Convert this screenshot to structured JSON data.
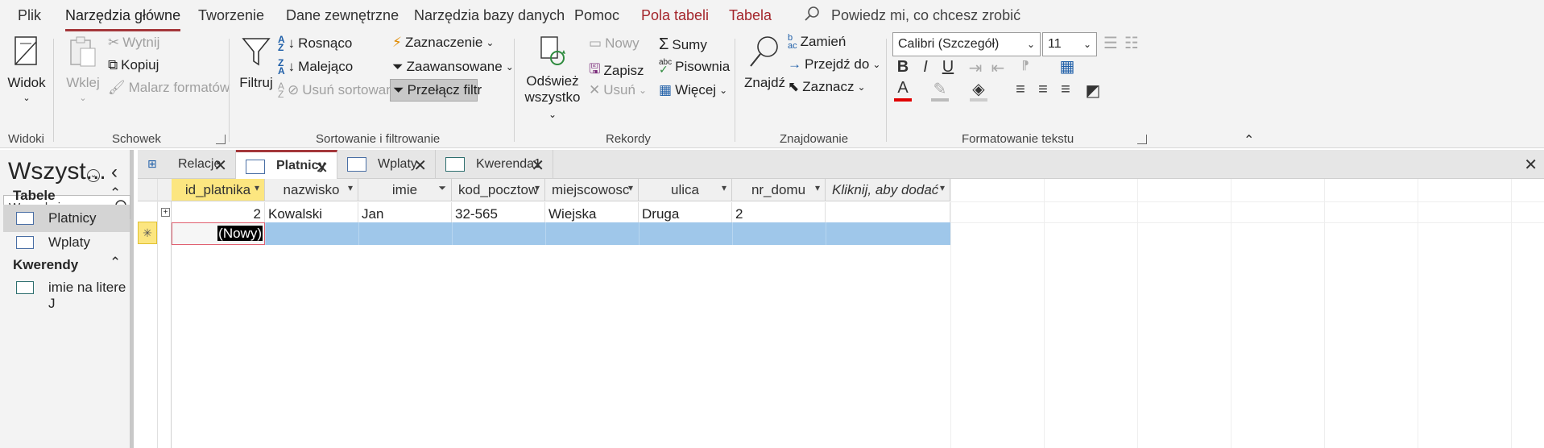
{
  "menu": {
    "tabs": [
      "Plik",
      "Narzędzia główne",
      "Tworzenie",
      "Dane zewnętrzne",
      "Narzędzia bazy danych",
      "Pomoc",
      "Pola tabeli",
      "Tabela"
    ],
    "tell_me": "Powiedz mi, co chcesz zrobić"
  },
  "ribbon": {
    "widoki": {
      "view": "Widok",
      "label": "Widoki"
    },
    "schowek": {
      "paste": "Wklej",
      "cut": "Wytnij",
      "copy": "Kopiuj",
      "painter": "Malarz formatów",
      "label": "Schowek"
    },
    "sort": {
      "filter": "Filtruj",
      "asc": "Rosnąco",
      "desc": "Malejąco",
      "remove": "Usuń sortowanie",
      "selection": "Zaznaczenie",
      "advanced": "Zaawansowane",
      "toggle": "Przełącz filtr",
      "label": "Sortowanie i filtrowanie"
    },
    "records": {
      "refresh1": "Odśwież",
      "refresh2": "wszystko",
      "new": "Nowy",
      "save": "Zapisz",
      "delete": "Usuń",
      "totals": "Sumy",
      "spelling": "Pisownia",
      "more": "Więcej",
      "label": "Rekordy"
    },
    "find": {
      "find": "Znajdź",
      "replace": "Zamień",
      "goto": "Przejdź do",
      "select": "Zaznacz",
      "label": "Znajdowanie"
    },
    "format": {
      "font": "Calibri (Szczegół)",
      "size": "11",
      "label": "Formatowanie tekstu"
    }
  },
  "nav": {
    "title": "Wszyst...",
    "search_placeholder": "Wyszukaj...",
    "sections": [
      {
        "name": "Tabele",
        "items": [
          "Platnicy",
          "Wplaty"
        ]
      },
      {
        "name": "Kwerendy",
        "items": [
          "imie na litere J"
        ]
      }
    ]
  },
  "doc_tabs": [
    "Relacje",
    "Platnicy",
    "Wplaty",
    "Kwerenda1"
  ],
  "grid": {
    "columns": [
      "id_platnika",
      "nazwisko",
      "imie",
      "kod_pocztow",
      "miejscowosc",
      "ulica",
      "nr_domu",
      "Kliknij, aby dodać"
    ],
    "rows": [
      [
        "2",
        "Kowalski",
        "Jan",
        "32-565",
        "Wiejska",
        "Druga",
        "2",
        ""
      ]
    ],
    "new_row_label": "(Nowy)"
  },
  "colors": {
    "accent": "#a4373a",
    "selection": "#9fc7ea",
    "header_active": "#fce680"
  }
}
